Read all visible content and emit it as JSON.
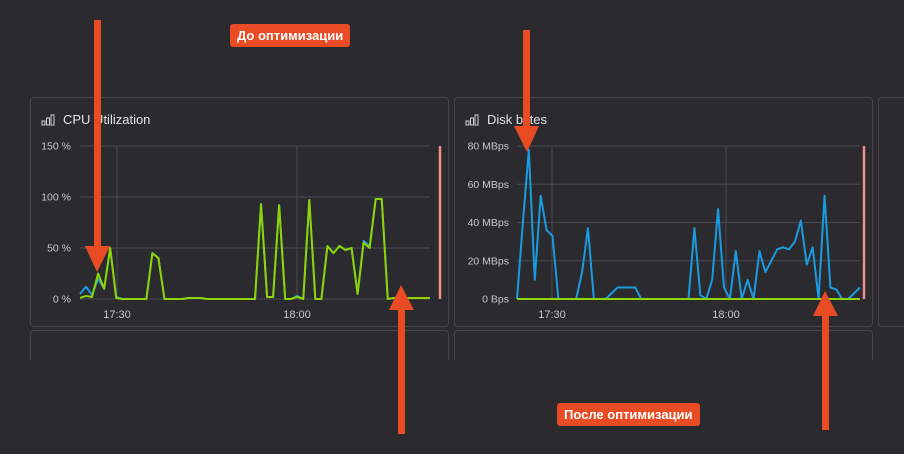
{
  "annotations": {
    "before_label": "До оптимизации",
    "after_label": "После оптимизации"
  },
  "colors": {
    "background": "#2b2a2f",
    "accent_orange": "#e94b24",
    "series_blue": "#1a9be0",
    "series_green": "#8fd400",
    "now_marker": "#f08c8c"
  },
  "panels": [
    {
      "title": "CPU Utilization",
      "icon": "bar-chart-icon"
    },
    {
      "title": "Disk bytes",
      "icon": "bar-chart-icon"
    }
  ],
  "chart_data": [
    {
      "type": "line",
      "title": "CPU Utilization",
      "xlabel": "",
      "ylabel": "",
      "x_ticks": [
        "17:30",
        "18:00"
      ],
      "y_ticks": [
        "0 %",
        "50 %",
        "100 %",
        "150 %"
      ],
      "ylim": [
        0,
        150
      ],
      "x_range_minutes": [
        17.5,
        19.5
      ],
      "grid": true,
      "x": [
        20,
        21,
        22,
        23,
        24,
        25,
        26,
        27,
        28,
        29,
        30,
        31,
        32,
        33,
        34,
        35,
        36,
        37,
        38,
        39,
        40,
        41,
        42,
        43,
        44,
        45,
        46,
        47,
        48,
        49,
        50,
        51,
        52,
        53,
        54,
        55,
        56,
        57,
        58,
        59,
        60,
        61,
        62,
        63,
        64,
        65,
        66,
        67,
        68,
        69,
        70,
        71,
        72,
        73,
        74,
        75,
        76,
        77,
        78
      ],
      "series": [
        {
          "color": "#1a9be0",
          "values": [
            5,
            12,
            4,
            20,
            10,
            50,
            2,
            0,
            0,
            0,
            0,
            0,
            45,
            40,
            0,
            0,
            0,
            0,
            1,
            1,
            1,
            0,
            0,
            0,
            0,
            0,
            0,
            0,
            0,
            0,
            93,
            2,
            2,
            92,
            0,
            0,
            3,
            0,
            97,
            0,
            0,
            52,
            45,
            52,
            48,
            50,
            5,
            57,
            52,
            98,
            98,
            0,
            1,
            1,
            1,
            1,
            1,
            1,
            1
          ]
        },
        {
          "color": "#8fd400",
          "values": [
            1,
            3,
            2,
            25,
            10,
            50,
            1,
            0,
            0,
            0,
            0,
            0,
            45,
            40,
            0,
            0,
            0,
            0,
            1,
            1,
            1,
            0,
            0,
            0,
            0,
            0,
            0,
            0,
            0,
            0,
            93,
            2,
            2,
            92,
            0,
            0,
            2,
            0,
            97,
            0,
            0,
            52,
            45,
            52,
            48,
            50,
            5,
            55,
            50,
            98,
            98,
            0,
            1,
            1,
            1,
            1,
            1,
            1,
            1
          ]
        }
      ]
    },
    {
      "type": "line",
      "title": "Disk bytes",
      "xlabel": "",
      "ylabel": "",
      "x_ticks": [
        "17:30",
        "18:00"
      ],
      "y_ticks": [
        "0 Bps",
        "20 MBps",
        "40 MBps",
        "60 MBps",
        "80 MBps"
      ],
      "ylim": [
        0,
        80
      ],
      "grid": true,
      "x": [
        20,
        21,
        22,
        23,
        24,
        25,
        26,
        27,
        28,
        29,
        30,
        31,
        32,
        33,
        34,
        35,
        36,
        37,
        38,
        39,
        40,
        41,
        42,
        43,
        44,
        45,
        46,
        47,
        48,
        49,
        50,
        51,
        52,
        53,
        54,
        55,
        56,
        57,
        58,
        59,
        60,
        61,
        62,
        63,
        64,
        65,
        66,
        67,
        68,
        69,
        70,
        71,
        72,
        73,
        74,
        75,
        76,
        77,
        78
      ],
      "series": [
        {
          "color": "#1a9be0",
          "values": [
            0,
            40,
            78,
            10,
            54,
            36,
            33,
            0,
            0,
            0,
            0,
            14,
            37,
            0,
            0,
            0,
            3,
            6,
            6,
            6,
            6,
            0,
            0,
            0,
            0,
            0,
            0,
            0,
            0,
            0,
            37,
            2,
            0,
            10,
            47,
            6,
            0,
            25,
            0,
            10,
            0,
            25,
            14,
            20,
            26,
            27,
            26,
            30,
            41,
            18,
            27,
            0,
            54,
            6,
            5,
            0,
            0,
            3,
            6
          ]
        },
        {
          "color": "#8fd400",
          "values": [
            0,
            0,
            0,
            0,
            0,
            0,
            0,
            0,
            0,
            0,
            0,
            0,
            0,
            0,
            0,
            0,
            0,
            0,
            0,
            0,
            0,
            0,
            0,
            0,
            0,
            0,
            0,
            0,
            0,
            0,
            0,
            0,
            0,
            0,
            0,
            0,
            0,
            0,
            0,
            0,
            0,
            0,
            0,
            0,
            0,
            0,
            0,
            0,
            0,
            0,
            0,
            0,
            0,
            0,
            0,
            0,
            0,
            0,
            0
          ]
        }
      ]
    }
  ]
}
